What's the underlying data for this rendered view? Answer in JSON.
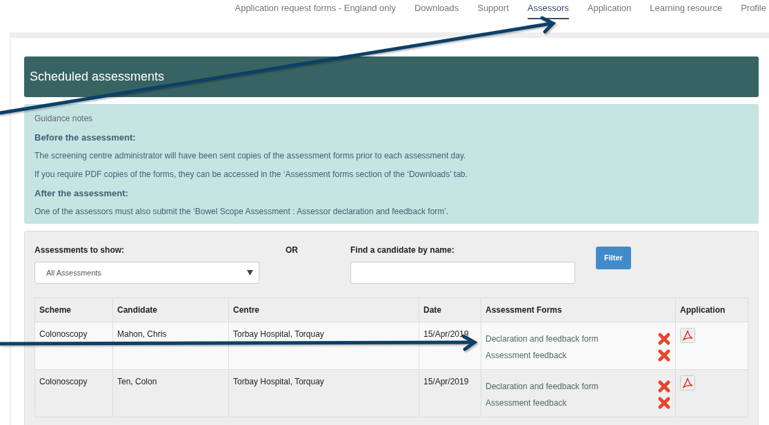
{
  "nav": [
    {
      "label": "Application request forms - England only",
      "selected": false
    },
    {
      "label": "Downloads",
      "selected": false
    },
    {
      "label": "Support",
      "selected": false
    },
    {
      "label": "Assessors",
      "selected": true
    },
    {
      "label": "Application",
      "selected": false
    },
    {
      "label": "Learning resource",
      "selected": false
    },
    {
      "label": "Profile",
      "selected": false
    }
  ],
  "title": "Scheduled assessments",
  "guidance": [
    {
      "kind": "caption",
      "text": "Guidance notes"
    },
    {
      "kind": "heading",
      "text": "Before the assessment:"
    },
    {
      "kind": "text",
      "text": "The screening centre administrator will have been sent copies of the assessment forms prior to each assessment day."
    },
    {
      "kind": "text",
      "text": "If you require PDF copies of the forms, they can be accessed in the ‘Assessment forms section of the ‘Downloads’ tab."
    },
    {
      "kind": "heading",
      "text": "After the assessment:"
    },
    {
      "kind": "text",
      "text": "One of the assessors must also submit the ‘Bowel Scope Assessment : Assessor declaration and feedback form’."
    }
  ],
  "filter": {
    "select_label": "Assessments to show:",
    "select_value": "All Assessments",
    "or_label": "OR",
    "search_label": "Find a candidate by name:",
    "button": "Filter"
  },
  "table": {
    "columns": [
      "Scheme",
      "Candidate",
      "Centre",
      "Date",
      "Assessment Forms",
      "Application"
    ],
    "rows": [
      {
        "scheme": "Colonoscopy",
        "candidate": "Mahon, Chris",
        "centre": "Torbay Hospital, Torquay",
        "date": "15/Apr/2019",
        "forms": [
          {
            "label": "Declaration and feedback form",
            "submitted": false
          },
          {
            "label": "Assessment feedback",
            "submitted": false
          }
        ]
      },
      {
        "scheme": "Colonoscopy",
        "candidate": "Ten, Colon",
        "centre": "Torbay Hospital, Torquay",
        "date": "15/Apr/2019",
        "forms": [
          {
            "label": "Declaration and feedback form",
            "submitted": false
          },
          {
            "label": "Assessment feedback",
            "submitted": false
          }
        ]
      }
    ]
  }
}
